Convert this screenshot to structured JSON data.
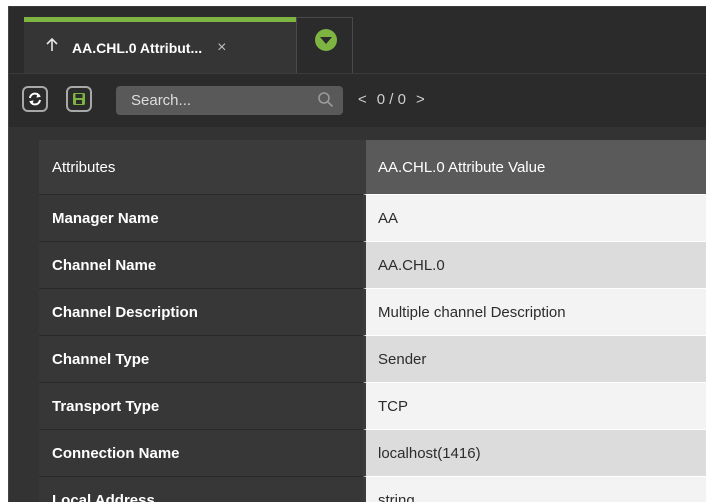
{
  "tab": {
    "title": "AA.CHL.0 Attribut...",
    "close": "×"
  },
  "toolbar": {
    "search_placeholder": "Search...",
    "pager_prev": "<",
    "pager_text": "0 / 0",
    "pager_next": ">"
  },
  "table": {
    "headers": [
      "Attributes",
      "AA.CHL.0 Attribute Value"
    ],
    "rows": [
      [
        "Manager Name",
        "AA"
      ],
      [
        "Channel Name",
        "AA.CHL.0"
      ],
      [
        "Channel Description",
        "Multiple channel Description"
      ],
      [
        "Channel Type",
        "Sender"
      ],
      [
        "Transport Type",
        "TCP"
      ],
      [
        "Connection Name",
        "localhost(1416)"
      ],
      [
        "Local Address",
        "string"
      ]
    ]
  },
  "colors": {
    "accent": "#7db442",
    "panel": "#2b2b2b"
  },
  "icons": [
    "up-arrow-icon",
    "close-icon",
    "chevron-down-icon",
    "refresh-icon",
    "save-icon",
    "search-icon"
  ]
}
